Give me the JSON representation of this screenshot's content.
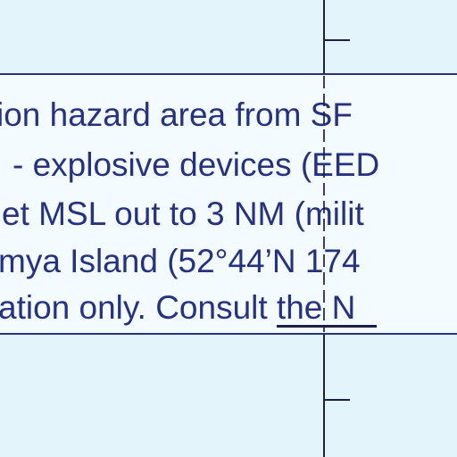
{
  "notice": {
    "lines": [
      "ion hazard area from SF",
      "- explosive devices (EED",
      "et MSL out to 3 NM (milit",
      "mya Island (52°44’N 174",
      "ation only. Consult the N"
    ]
  },
  "colors": {
    "water": "#e3f4fa",
    "notice_background": "#f3fbfe",
    "notice_text": "#27327e",
    "meridian_line": "#1d1f4a"
  }
}
